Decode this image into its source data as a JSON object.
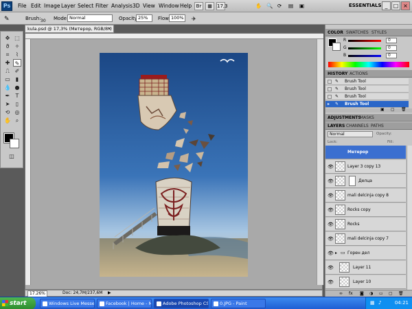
{
  "app": {
    "logo": "Ps",
    "zoom_field": "17,3",
    "workspace": "ESSENTIALS"
  },
  "menu": [
    "File",
    "Edit",
    "Image",
    "Layer",
    "Select",
    "Filter",
    "Analysis",
    "3D",
    "View",
    "Window",
    "Help"
  ],
  "options": {
    "brush_label": "Brush:",
    "brush_size": "30",
    "mode_label": "Mode:",
    "mode_value": "Normal",
    "opacity_label": "Opacity:",
    "opacity_value": "25%",
    "flow_label": "Flow:",
    "flow_value": "100%"
  },
  "document": {
    "tab_title": "kula.psd @ 17,3% (Метероp, RGB/8*) *",
    "close": "×"
  },
  "status": {
    "zoom": "17.26%",
    "doc": "Doc: 24,7M/237,6M"
  },
  "color_panel": {
    "tabs": [
      "COLOR",
      "SWATCHES",
      "STYLES"
    ],
    "channels": [
      {
        "label": "R",
        "value": "0"
      },
      {
        "label": "G",
        "value": "0"
      },
      {
        "label": "B",
        "value": "0"
      }
    ]
  },
  "history_panel": {
    "tabs": [
      "HISTORY",
      "ACTIONS"
    ],
    "items": [
      "Brush Tool",
      "Brush Tool",
      "Brush Tool",
      "Brush Tool"
    ]
  },
  "adjustments_tabs": [
    "ADJUSTMENTS",
    "MASKS"
  ],
  "layers_panel": {
    "tabs": [
      "LAYERS",
      "CHANNELS",
      "PATHS"
    ],
    "blend_mode": "Normal",
    "opacity_label": "Opacity:",
    "fill_label": "Fill:",
    "lock_label": "Lock:",
    "layers": [
      {
        "name": "Метероp",
        "selected": true
      },
      {
        "name": "Layer 3 copy 13",
        "selected": false
      },
      {
        "name": "Делца",
        "selected": false
      },
      {
        "name": "mali delcinja copy 8",
        "selected": false
      },
      {
        "name": "Rocks copy",
        "selected": false
      },
      {
        "name": "Rocks",
        "selected": false
      },
      {
        "name": "mali delcinja copy 7",
        "selected": false
      },
      {
        "name": "Горен дел",
        "selected": false
      },
      {
        "name": "Layer 11",
        "selected": false
      },
      {
        "name": "Layer 10",
        "selected": false
      }
    ]
  },
  "taskbar": {
    "start": "start",
    "tasks": [
      {
        "label": "Windows Live Messen...",
        "active": false
      },
      {
        "label": "Facebook | Home - M...",
        "active": false
      },
      {
        "label": "Adobe Photoshop CS...",
        "active": true
      },
      {
        "label": "0.JPG - Paint",
        "active": false
      }
    ],
    "clock": "04:21"
  },
  "colors": {
    "accent": "#2a66c8",
    "taskbar": "#245edb",
    "sky": "#1f4d8c"
  }
}
